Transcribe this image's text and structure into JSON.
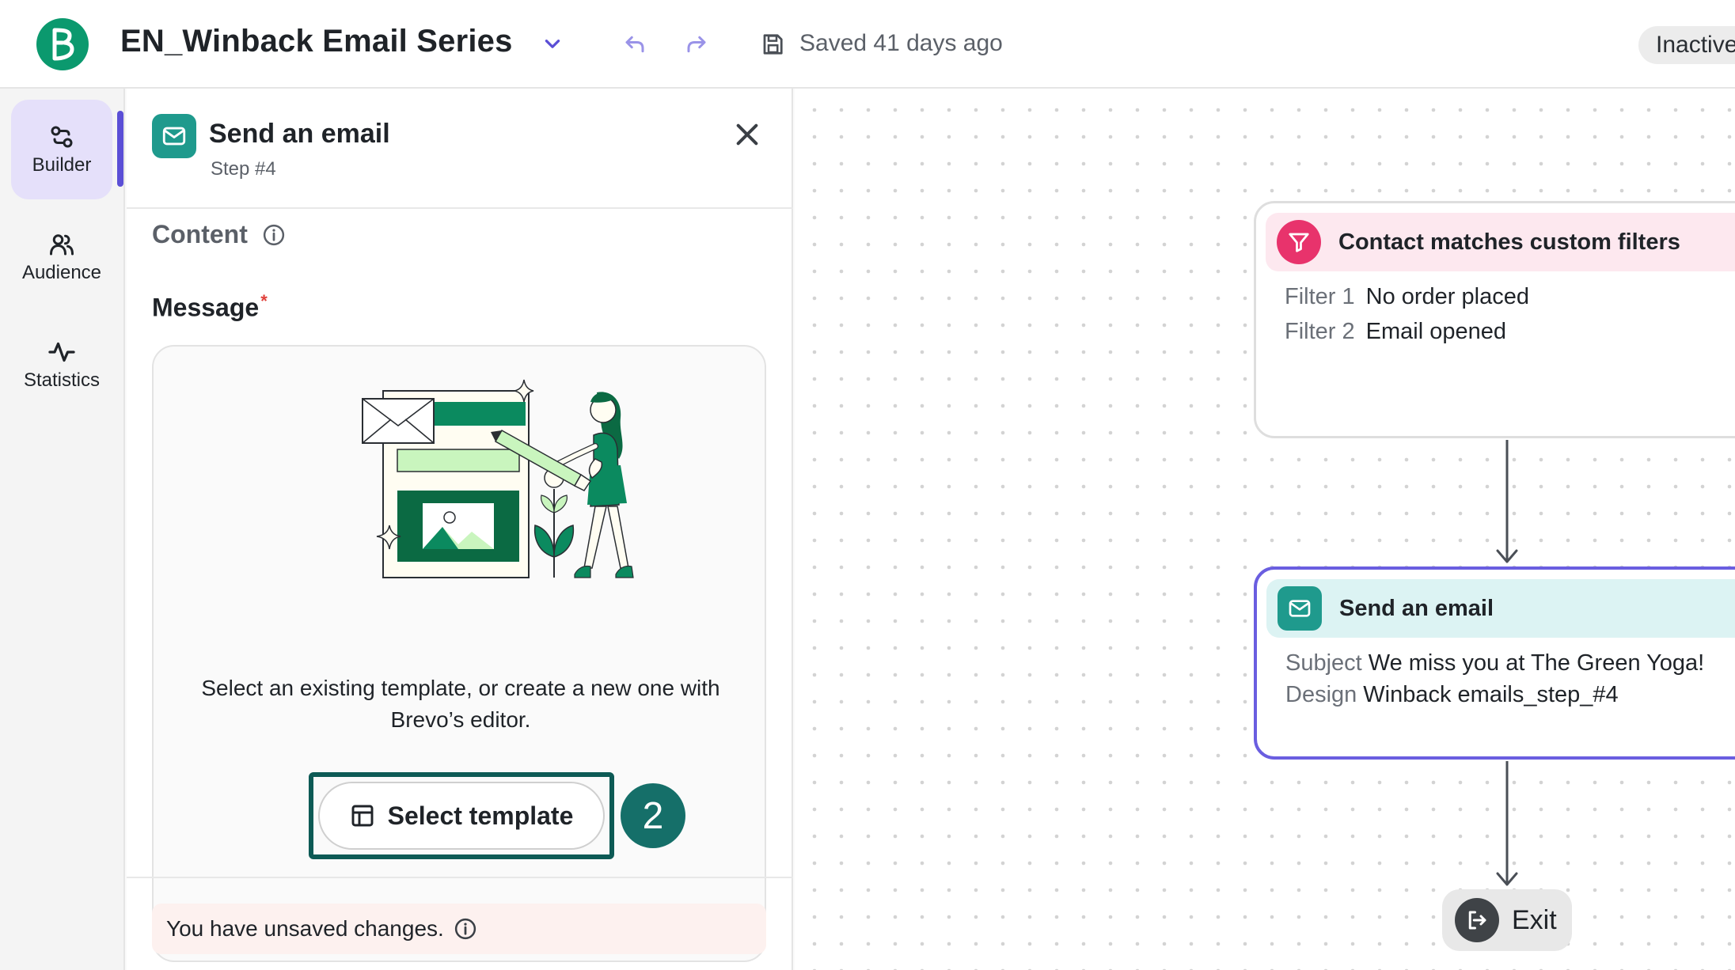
{
  "header": {
    "title": "EN_Winback Email Series",
    "saved_status": "Saved 41 days ago",
    "workflow_status": "Inactive",
    "icons": {
      "logo": "brevo-logo",
      "dropdown": "chevron-down-icon",
      "undo": "undo-icon",
      "redo": "redo-icon",
      "save": "save-icon"
    }
  },
  "sidebar": {
    "items": [
      {
        "label": "Builder",
        "icon": "builder-icon",
        "active": true
      },
      {
        "label": "Audience",
        "icon": "users-icon",
        "active": false
      },
      {
        "label": "Statistics",
        "icon": "activity-icon",
        "active": false
      }
    ]
  },
  "panel": {
    "title": "Send an email",
    "subtitle": "Step #4",
    "content_label": "Content",
    "message_label": "Message",
    "required_mark": "*",
    "description": "Select an existing template, or create a new one with Brevo’s editor.",
    "select_template_label": "Select template",
    "step_badge": "2",
    "unsaved_notice": "You have unsaved changes."
  },
  "canvas": {
    "filter_node": {
      "title": "Contact matches custom filters",
      "filters": [
        {
          "key": "Filter 1",
          "value": "No order placed"
        },
        {
          "key": "Filter 2",
          "value": "Email opened"
        }
      ]
    },
    "email_node": {
      "title": "Send an email",
      "subject_key": "Subject",
      "subject_value": "We miss you at The Green Yoga!",
      "design_key": "Design",
      "design_value": "Winback emails_step_#4"
    },
    "exit_label": "Exit"
  },
  "colors": {
    "brand_green": "#0b996e",
    "accent_purple": "#6a5ee0",
    "teal": "#1f9a8d",
    "filter_pink": "#e8336c",
    "badge_teal": "#156f69"
  }
}
